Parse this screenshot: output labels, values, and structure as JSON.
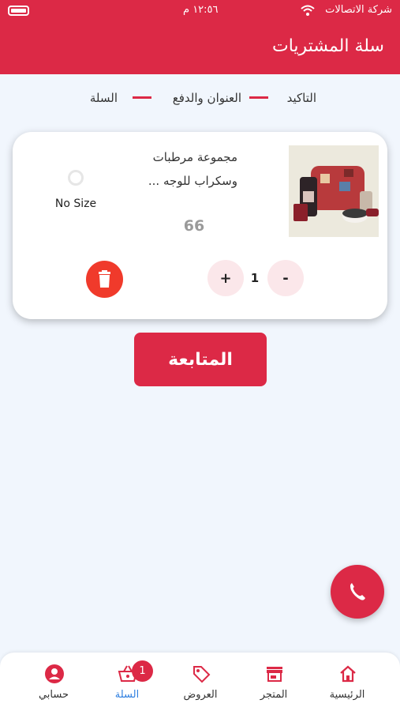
{
  "status_bar": {
    "carrier": "شركة الاتصالات",
    "time": "١٢:٥٦ م"
  },
  "header": {
    "title": "سلة المشتريات"
  },
  "stepper": {
    "steps": [
      "التاكيد",
      "العنوان والدفع",
      "السلة"
    ]
  },
  "cart": {
    "item": {
      "name_line1": "مجموعة مرطبات",
      "name_line2": "وسكراب للوجه ...",
      "size": "No Size",
      "price": "66",
      "quantity": "1",
      "increment_label": "+",
      "decrement_label": "-"
    }
  },
  "actions": {
    "continue_label": "المتابعة"
  },
  "bottom_nav": {
    "items": [
      "الرئيسية",
      "المتجر",
      "العروض",
      "السلة",
      "حسابي"
    ],
    "active": "السلة",
    "cart_badge": "1"
  },
  "colors": {
    "primary": "#dc2946",
    "delete": "#f03a2b",
    "active_nav": "#2f7fe0",
    "background": "#f1f6fd"
  }
}
